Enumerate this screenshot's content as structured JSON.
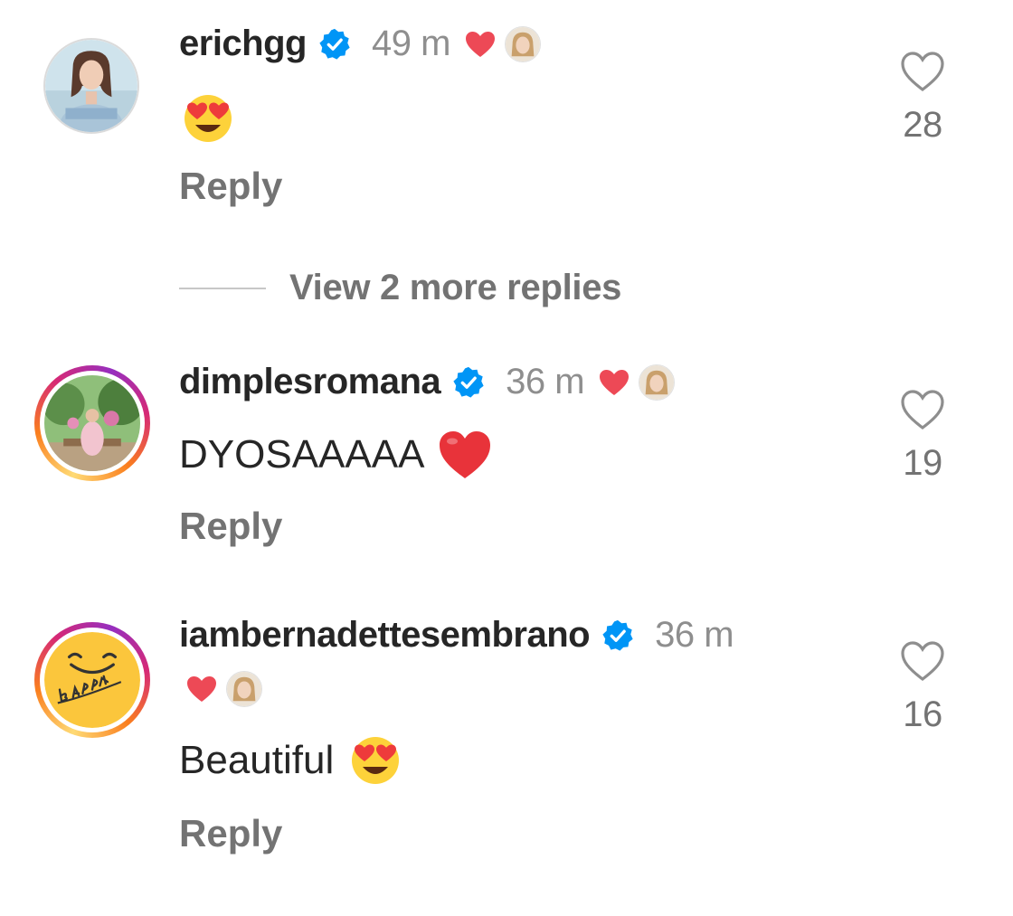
{
  "comments": [
    {
      "username": "erichgg",
      "time": "49 m",
      "text": "",
      "reply_label": "Reply",
      "like_count": "28",
      "avatar_icon": "woman-portrait-avatar",
      "verified_icon": "verified-badge-icon"
    },
    {
      "username": "dimplesromana",
      "time": "36 m",
      "text": "DYOSAAAAA",
      "reply_label": "Reply",
      "like_count": "19",
      "avatar_icon": "garden-portrait-avatar",
      "verified_icon": "verified-badge-icon"
    },
    {
      "username": "iambernadettesembrano",
      "time": "36 m",
      "text": "Beautiful",
      "reply_label": "Reply",
      "like_count": "16",
      "avatar_icon": "bhappy-logo-avatar",
      "verified_icon": "verified-badge-icon"
    }
  ],
  "view_more_replies": "View 2 more replies",
  "colors": {
    "verified_blue": "#0095f6",
    "heart_red": "#ed4956",
    "secondary_text": "#737373",
    "primary_text": "#262626"
  }
}
